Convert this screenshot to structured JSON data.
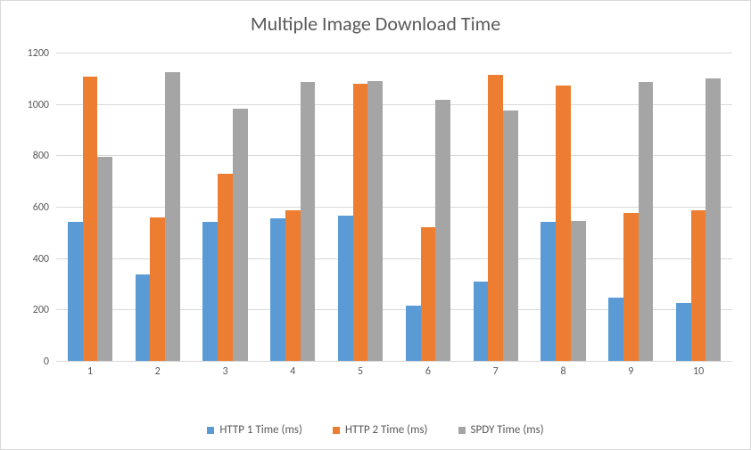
{
  "chart_data": {
    "type": "bar",
    "title": "Multiple Image Download Time",
    "xlabel": "",
    "ylabel": "",
    "ylim": [
      0,
      1200
    ],
    "ytick_step": 200,
    "categories": [
      "1",
      "2",
      "3",
      "4",
      "5",
      "6",
      "7",
      "8",
      "9",
      "10"
    ],
    "series": [
      {
        "name": "HTTP 1 Time (ms)",
        "values": [
          540,
          335,
          540,
          555,
          565,
          215,
          310,
          540,
          245,
          225
        ]
      },
      {
        "name": "HTTP 2 Time (ms)",
        "values": [
          1105,
          560,
          730,
          585,
          1080,
          520,
          1115,
          1070,
          575,
          585
        ]
      },
      {
        "name": "SPDY Time (ms)",
        "values": [
          795,
          1125,
          980,
          1085,
          1090,
          1015,
          975,
          545,
          1085,
          1100
        ]
      }
    ],
    "colors": [
      "#5b9bd5",
      "#ed7d31",
      "#a5a5a5"
    ]
  }
}
